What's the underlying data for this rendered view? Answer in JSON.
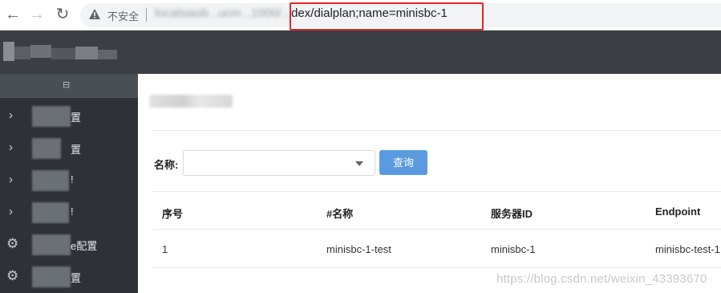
{
  "browser": {
    "back_icon": "arrow-left-icon",
    "forward_icon": "arrow-right-icon",
    "reload_icon": "reload-icon",
    "insecure_label": "不安全",
    "url_host": "localsiaob...ucm...1000/...",
    "url_path": "dex/dialplan;name=minisbc-1",
    "highlight_color": "#e0262b"
  },
  "sidebar": {
    "items": [
      {
        "icon": "chevron-right-icon",
        "label": "置"
      },
      {
        "icon": "chevron-right-icon",
        "label": "置"
      },
      {
        "icon": "chevron-right-icon",
        "label": "!"
      },
      {
        "icon": "chevron-right-icon",
        "label": "!"
      },
      {
        "icon": "gear-icon",
        "label": "e配置"
      },
      {
        "icon": "gear-icon",
        "label": "置"
      }
    ]
  },
  "filter": {
    "name_label": "名称:",
    "select_value": "",
    "query_button": "查询"
  },
  "table": {
    "columns": [
      "序号",
      "#名称",
      "服务器ID",
      "Endpoint"
    ],
    "rows": [
      [
        "1",
        "minisbc-1-test",
        "minisbc-1",
        "minisbc-test-1"
      ]
    ]
  },
  "watermark": "https://blog.csdn.net/weixin_43393670",
  "colors": {
    "accent": "#5a9bdf",
    "sidebar": "#2e3136",
    "header": "#3b3f44"
  }
}
